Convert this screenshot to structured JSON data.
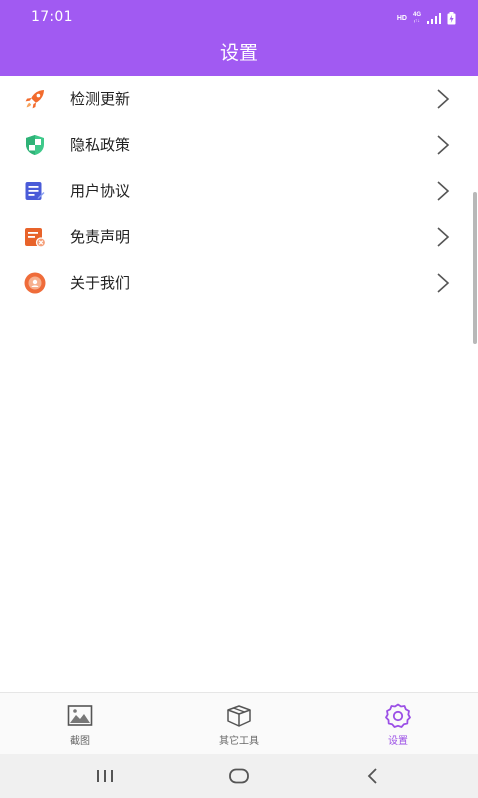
{
  "status_bar": {
    "time": "17:01",
    "hd": "HD",
    "network_top": "4G",
    "network_bottom": "ᵢ↑↓"
  },
  "header": {
    "title": "设置"
  },
  "menu": {
    "items": [
      {
        "label": "检测更新",
        "icon": "rocket-icon"
      },
      {
        "label": "隐私政策",
        "icon": "shield-icon"
      },
      {
        "label": "用户协议",
        "icon": "document-icon"
      },
      {
        "label": "免责声明",
        "icon": "disclaimer-icon"
      },
      {
        "label": "关于我们",
        "icon": "about-icon"
      }
    ]
  },
  "tabbar": {
    "tabs": [
      {
        "label": "截图",
        "icon": "image-icon",
        "active": false
      },
      {
        "label": "其它工具",
        "icon": "toolbox-icon",
        "active": false
      },
      {
        "label": "设置",
        "icon": "gear-icon",
        "active": true
      }
    ]
  },
  "colors": {
    "header": "#a15af2",
    "active_tab": "#9b4fe6",
    "rocket": "#f26b2d",
    "shield": "#3ec98a",
    "document": "#4a5bd8",
    "disclaimer": "#e8632a",
    "about": "#ef6c3a"
  }
}
